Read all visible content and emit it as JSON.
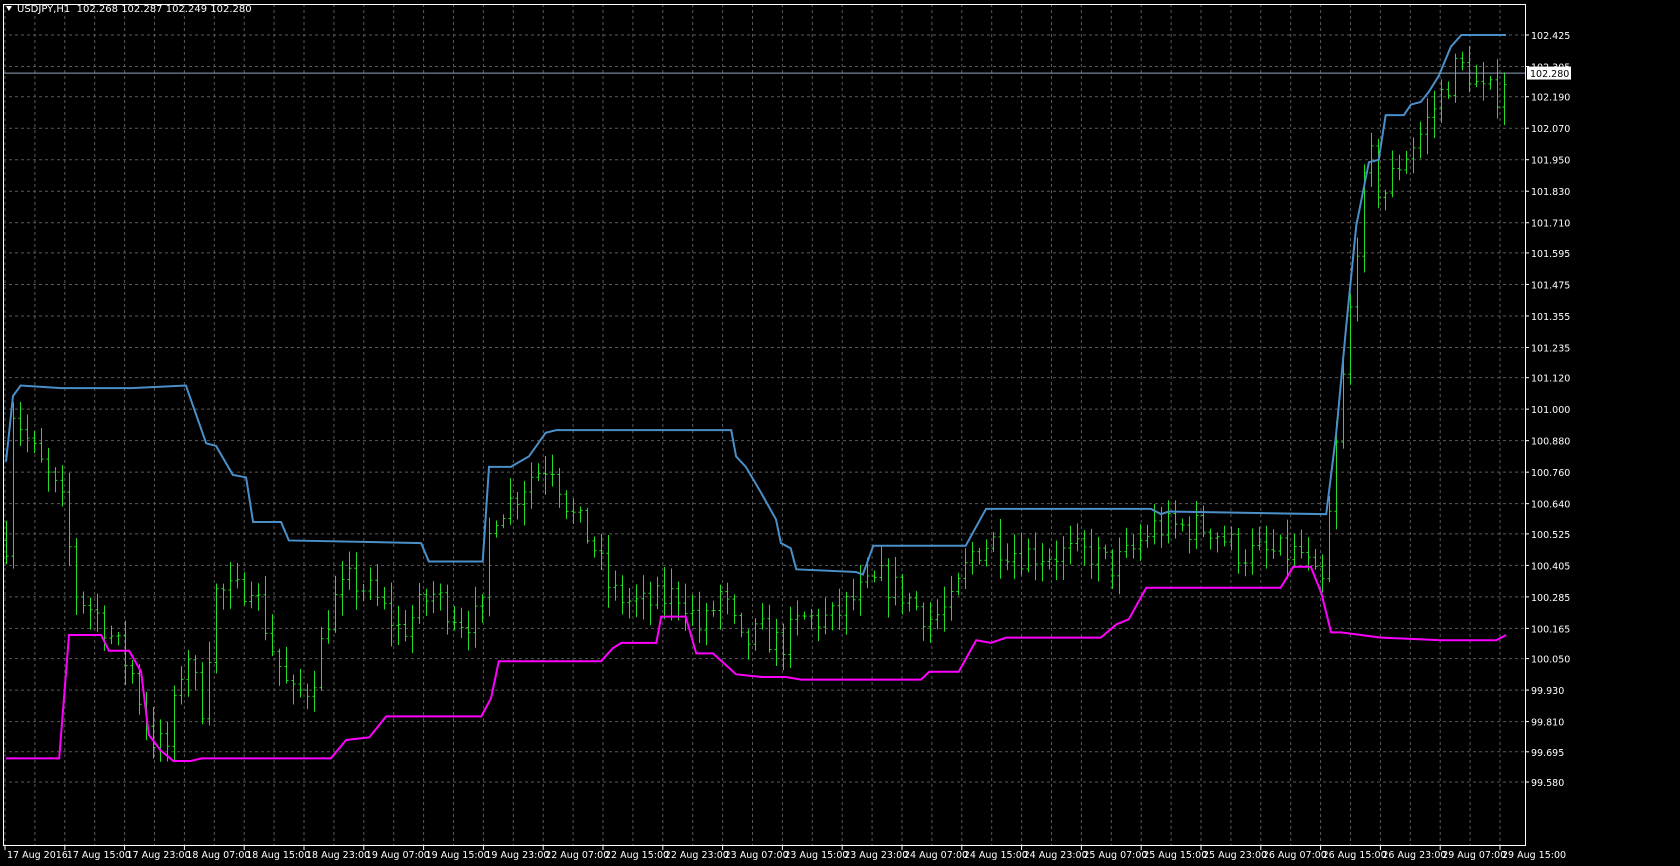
{
  "header": {
    "symbol": "USDJPY,H1",
    "ohlc": "102.268 102.287 102.249 102.280"
  },
  "colors": {
    "background": "#000000",
    "grid": "#5a5a5a",
    "bars": "#22dd22",
    "upper": "#4a8fc8",
    "lower": "#ff00ff",
    "axis": "#ffffff"
  },
  "chart_data": {
    "type": "line",
    "title": "USDJPY,H1",
    "current_price": "102.280",
    "ylim": [
      99.58,
      102.425
    ],
    "y_ticks": [
      "102.425",
      "102.305",
      "102.190",
      "102.070",
      "101.950",
      "101.830",
      "101.710",
      "101.595",
      "101.475",
      "101.355",
      "101.235",
      "101.120",
      "101.000",
      "100.880",
      "100.760",
      "100.640",
      "100.525",
      "100.405",
      "100.285",
      "100.165",
      "100.050",
      "99.930",
      "99.810",
      "99.695",
      "99.580"
    ],
    "x_ticks": [
      "17 Aug 2016",
      "17 Aug 15:00",
      "17 Aug 23:00",
      "18 Aug 07:00",
      "18 Aug 15:00",
      "18 Aug 23:00",
      "19 Aug 07:00",
      "19 Aug 15:00",
      "19 Aug 23:00",
      "22 Aug 07:00",
      "22 Aug 15:00",
      "22 Aug 23:00",
      "23 Aug 07:00",
      "23 Aug 15:00",
      "23 Aug 23:00",
      "24 Aug 07:00",
      "24 Aug 15:00",
      "24 Aug 23:00",
      "25 Aug 07:00",
      "25 Aug 15:00",
      "25 Aug 23:00",
      "26 Aug 07:00",
      "26 Aug 15:00",
      "26 Aug 23:00",
      "29 Aug 07:00",
      "29 Aug 15:00"
    ],
    "bar_count": 215,
    "price_bars_close_path": [
      [
        0,
        100.5
      ],
      [
        1,
        101.0
      ],
      [
        3.6,
        100.85
      ],
      [
        7.9,
        100.65
      ],
      [
        10,
        100.3
      ],
      [
        13.6,
        100.2
      ],
      [
        17.9,
        100.0
      ],
      [
        20.7,
        99.75
      ],
      [
        22.9,
        99.7
      ],
      [
        25.7,
        100.1
      ],
      [
        27.9,
        99.85
      ],
      [
        30,
        100.3
      ],
      [
        32.9,
        100.3
      ],
      [
        35,
        100.35
      ],
      [
        37.9,
        100.1
      ],
      [
        40.7,
        99.9
      ],
      [
        43.6,
        99.95
      ],
      [
        46.4,
        100.25
      ],
      [
        49.3,
        100.35
      ],
      [
        52.1,
        100.3
      ],
      [
        56.4,
        100.15
      ],
      [
        60.7,
        100.3
      ],
      [
        65,
        100.2
      ],
      [
        67.9,
        100.2
      ],
      [
        69.3,
        100.6
      ],
      [
        72.1,
        100.65
      ],
      [
        75,
        100.75
      ],
      [
        77.9,
        100.8
      ],
      [
        80.7,
        100.6
      ],
      [
        83.6,
        100.5
      ],
      [
        86.4,
        100.3
      ],
      [
        90.7,
        100.25
      ],
      [
        96.4,
        100.3
      ],
      [
        99.3,
        100.15
      ],
      [
        102.1,
        100.3
      ],
      [
        105,
        100.1
      ],
      [
        107.9,
        100.15
      ],
      [
        110.7,
        100.1
      ],
      [
        113.6,
        100.2
      ],
      [
        117.9,
        100.2
      ],
      [
        122.1,
        100.3
      ],
      [
        125,
        100.35
      ],
      [
        127.9,
        100.3
      ],
      [
        132.1,
        100.2
      ],
      [
        135,
        100.25
      ],
      [
        137.9,
        100.45
      ],
      [
        140.7,
        100.5
      ],
      [
        145,
        100.45
      ],
      [
        155,
        100.45
      ],
      [
        157.9,
        100.4
      ],
      [
        160.7,
        100.45
      ],
      [
        163.6,
        100.55
      ],
      [
        172.1,
        100.55
      ],
      [
        176.4,
        100.45
      ],
      [
        185,
        100.45
      ],
      [
        187.9,
        100.3
      ],
      [
        190,
        100.85
      ],
      [
        192.1,
        101.4
      ],
      [
        193.6,
        101.8
      ],
      [
        195,
        101.95
      ],
      [
        196.4,
        101.8
      ],
      [
        199.3,
        101.95
      ],
      [
        202.1,
        102.05
      ],
      [
        205,
        102.2
      ],
      [
        207.1,
        102.3
      ],
      [
        208.6,
        102.3
      ],
      [
        210.7,
        102.2
      ],
      [
        212.9,
        102.2
      ],
      [
        214.3,
        102.28
      ]
    ],
    "series": [
      {
        "name": "upper",
        "points": [
          [
            0,
            100.8
          ],
          [
            1,
            101.05
          ],
          [
            2.1,
            101.09
          ],
          [
            7.9,
            101.08
          ],
          [
            17.9,
            101.08
          ],
          [
            25.7,
            101.09
          ],
          [
            28.6,
            100.87
          ],
          [
            30,
            100.86
          ],
          [
            32.4,
            100.75
          ],
          [
            34.3,
            100.74
          ],
          [
            35.3,
            100.57
          ],
          [
            39.3,
            100.57
          ],
          [
            40.4,
            100.5
          ],
          [
            59.3,
            100.49
          ],
          [
            60.4,
            100.42
          ],
          [
            68.1,
            100.42
          ],
          [
            69,
            100.78
          ],
          [
            72.1,
            100.78
          ],
          [
            74.7,
            100.82
          ],
          [
            77.1,
            100.91
          ],
          [
            78.6,
            100.92
          ],
          [
            103.6,
            100.92
          ],
          [
            104.3,
            100.82
          ],
          [
            105.7,
            100.78
          ],
          [
            107.9,
            100.68
          ],
          [
            110,
            100.58
          ],
          [
            110.7,
            100.49
          ],
          [
            112.1,
            100.47
          ],
          [
            112.9,
            100.39
          ],
          [
            121.4,
            100.38
          ],
          [
            122.4,
            100.37
          ],
          [
            123.9,
            100.48
          ],
          [
            137.1,
            100.48
          ],
          [
            140,
            100.62
          ],
          [
            163.6,
            100.62
          ],
          [
            165,
            100.6
          ],
          [
            166.1,
            100.61
          ],
          [
            188.6,
            100.6
          ],
          [
            190,
            100.9
          ],
          [
            191.4,
            101.3
          ],
          [
            192.9,
            101.7
          ],
          [
            194.7,
            101.94
          ],
          [
            196.1,
            101.95
          ],
          [
            197.1,
            102.12
          ],
          [
            199.7,
            102.12
          ],
          [
            200.7,
            102.16
          ],
          [
            202.1,
            102.17
          ],
          [
            203.3,
            102.21
          ],
          [
            204.7,
            102.27
          ],
          [
            206.4,
            102.38
          ],
          [
            207.9,
            102.425
          ],
          [
            214.3,
            102.425
          ]
        ]
      },
      {
        "name": "lower",
        "points": [
          [
            0,
            99.67
          ],
          [
            7.6,
            99.67
          ],
          [
            9,
            100.14
          ],
          [
            13.6,
            100.14
          ],
          [
            14.7,
            100.08
          ],
          [
            17.6,
            100.08
          ],
          [
            19.3,
            100.0
          ],
          [
            20.4,
            99.76
          ],
          [
            22.1,
            99.7
          ],
          [
            23.9,
            99.66
          ],
          [
            26.4,
            99.66
          ],
          [
            27.9,
            99.67
          ],
          [
            46.4,
            99.67
          ],
          [
            48.6,
            99.74
          ],
          [
            51.9,
            99.75
          ],
          [
            54.3,
            99.83
          ],
          [
            67.9,
            99.83
          ],
          [
            69.3,
            99.9
          ],
          [
            70.4,
            100.04
          ],
          [
            85,
            100.04
          ],
          [
            86.7,
            100.09
          ],
          [
            87.9,
            100.11
          ],
          [
            92.9,
            100.11
          ],
          [
            93.6,
            100.21
          ],
          [
            97.1,
            100.21
          ],
          [
            98.6,
            100.07
          ],
          [
            101,
            100.07
          ],
          [
            104.3,
            99.99
          ],
          [
            107.9,
            99.98
          ],
          [
            111.4,
            99.98
          ],
          [
            113.6,
            99.97
          ],
          [
            130.7,
            99.97
          ],
          [
            131.9,
            100.0
          ],
          [
            136.1,
            100.0
          ],
          [
            138.6,
            100.12
          ],
          [
            140.7,
            100.11
          ],
          [
            142.9,
            100.13
          ],
          [
            156.4,
            100.13
          ],
          [
            158.6,
            100.18
          ],
          [
            160.4,
            100.2
          ],
          [
            162.9,
            100.32
          ],
          [
            182.1,
            100.32
          ],
          [
            183.9,
            100.4
          ],
          [
            186.4,
            100.4
          ],
          [
            187.9,
            100.3
          ],
          [
            189.3,
            100.15
          ],
          [
            190.7,
            100.15
          ],
          [
            196.4,
            100.13
          ],
          [
            205,
            100.12
          ],
          [
            212.9,
            100.12
          ],
          [
            214.3,
            100.14
          ]
        ]
      }
    ]
  }
}
